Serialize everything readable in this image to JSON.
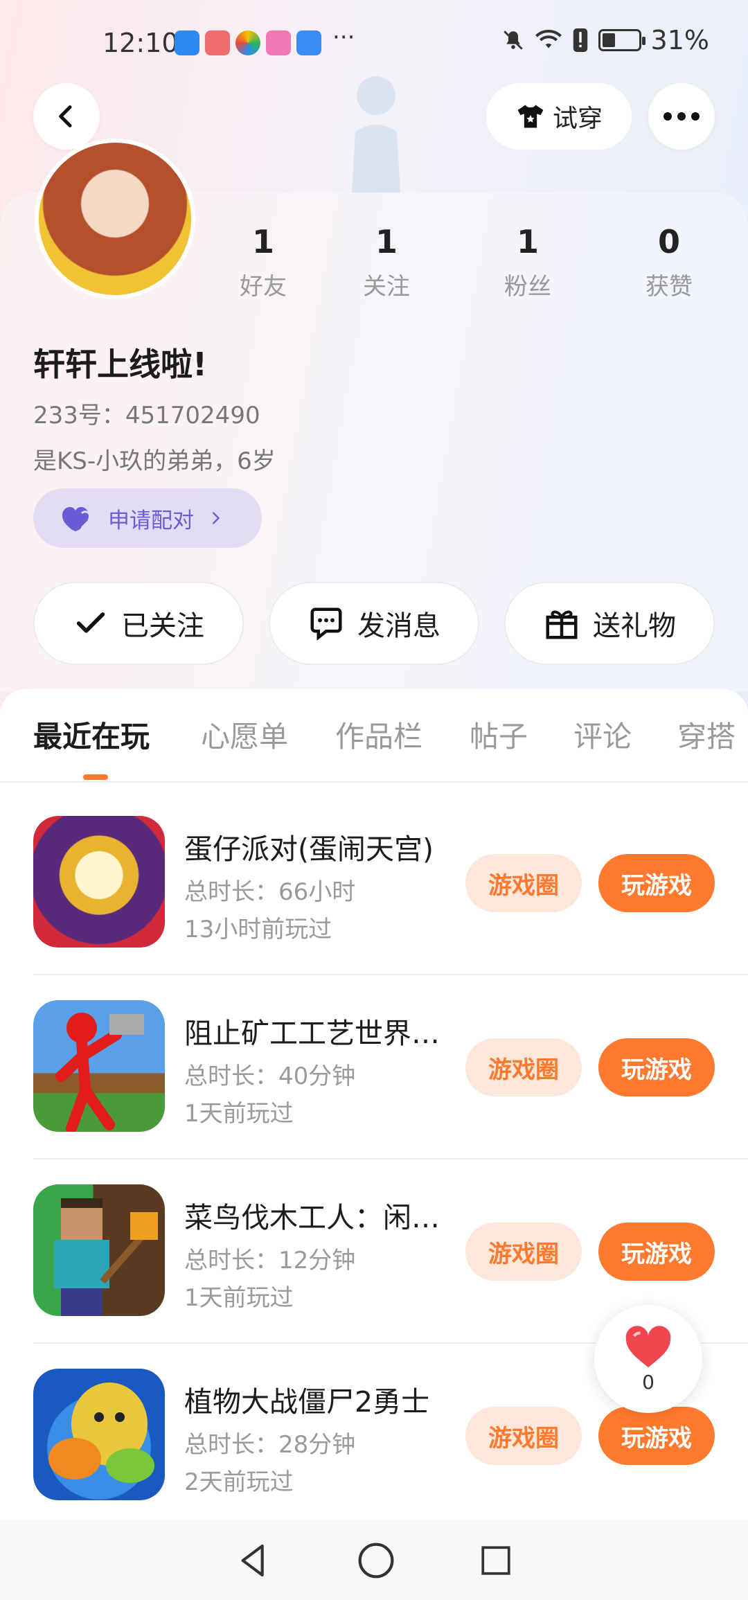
{
  "status_bar": {
    "time": "12:10",
    "more_indicator": "···",
    "battery_percent": "31%",
    "icons": [
      "shield-icon",
      "app-icon",
      "app-icon",
      "app-icon",
      "weather-icon",
      "bell-off-icon",
      "wifi-icon",
      "alert-icon",
      "battery-icon"
    ]
  },
  "header": {
    "back_icon": "chevron-left-icon",
    "tryon_label": "试穿",
    "more_icon": "more-horizontal-icon"
  },
  "profile": {
    "stats": [
      {
        "value": "1",
        "label": "好友"
      },
      {
        "value": "1",
        "label": "关注"
      },
      {
        "value": "1",
        "label": "粉丝"
      },
      {
        "value": "0",
        "label": "获赞"
      }
    ],
    "nickname": "轩轩上线啦!",
    "uid": "233号：451702490",
    "bio": "是KS-小玖的弟弟，6岁",
    "pair_label": "申请配对"
  },
  "actions": {
    "followed": "已关注",
    "message": "发消息",
    "gift": "送礼物"
  },
  "tabs": [
    "最近在玩",
    "心愿单",
    "作品栏",
    "帖子",
    "评论",
    "穿搭"
  ],
  "games": [
    {
      "title": "蛋仔派对(蛋闹天宫)",
      "duration": "总时长：66小时",
      "last_played": "13小时前玩过"
    },
    {
      "title": "阻止矿工工艺世界…",
      "duration": "总时长：40分钟",
      "last_played": "1天前玩过"
    },
    {
      "title": "菜鸟伐木工人：闲…",
      "duration": "总时长：12分钟",
      "last_played": "1天前玩过"
    },
    {
      "title": "植物大战僵尸2勇士",
      "duration": "总时长：28分钟",
      "last_played": "2天前玩过"
    }
  ],
  "game_buttons": {
    "circle": "游戏圈",
    "play": "玩游戏"
  },
  "like_widget": {
    "count": "0"
  },
  "colors": {
    "accent": "#ff7a2e",
    "accent_light": "#fde6da",
    "pair_bg": "#e3dcf5",
    "pair_text": "#6a5cd6"
  }
}
